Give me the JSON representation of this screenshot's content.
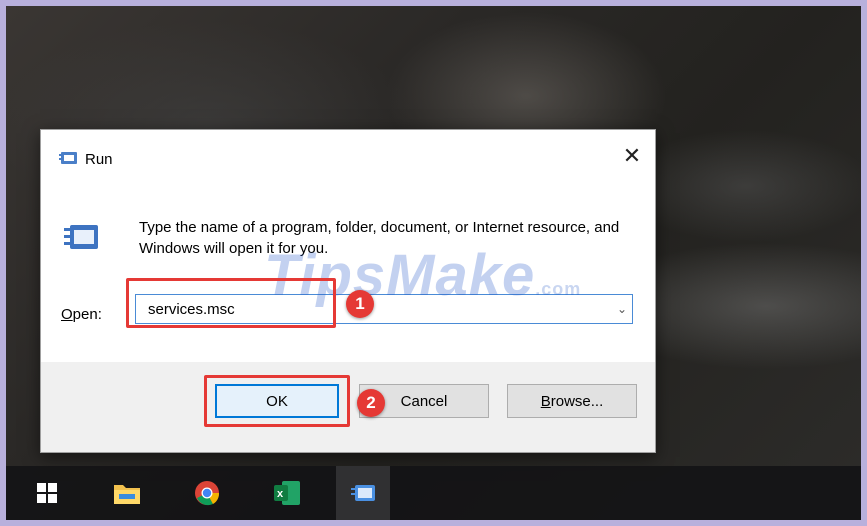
{
  "dialog": {
    "title": "Run",
    "close_glyph": "✕",
    "description": "Type the name of a program, folder, document, or Internet resource, and Windows will open it for you.",
    "open_label_prefix": "O",
    "open_label_rest": "pen:",
    "open_value": "services.msc",
    "ok_label": "OK",
    "cancel_label": "Cancel",
    "browse_label_prefix": "B",
    "browse_label_rest": "rowse..."
  },
  "annotations": {
    "marker_1": "1",
    "marker_2": "2",
    "callout_color": "#e53935"
  },
  "watermark": {
    "text": "TipsMake",
    "suffix": ".com"
  },
  "taskbar": {
    "items": [
      {
        "name": "windows-start-icon"
      },
      {
        "name": "file-explorer-icon"
      },
      {
        "name": "chrome-icon"
      },
      {
        "name": "excel-icon"
      },
      {
        "name": "run-app-icon",
        "active": true
      }
    ]
  },
  "colors": {
    "accent": "#0078d7",
    "callout": "#e53935"
  }
}
